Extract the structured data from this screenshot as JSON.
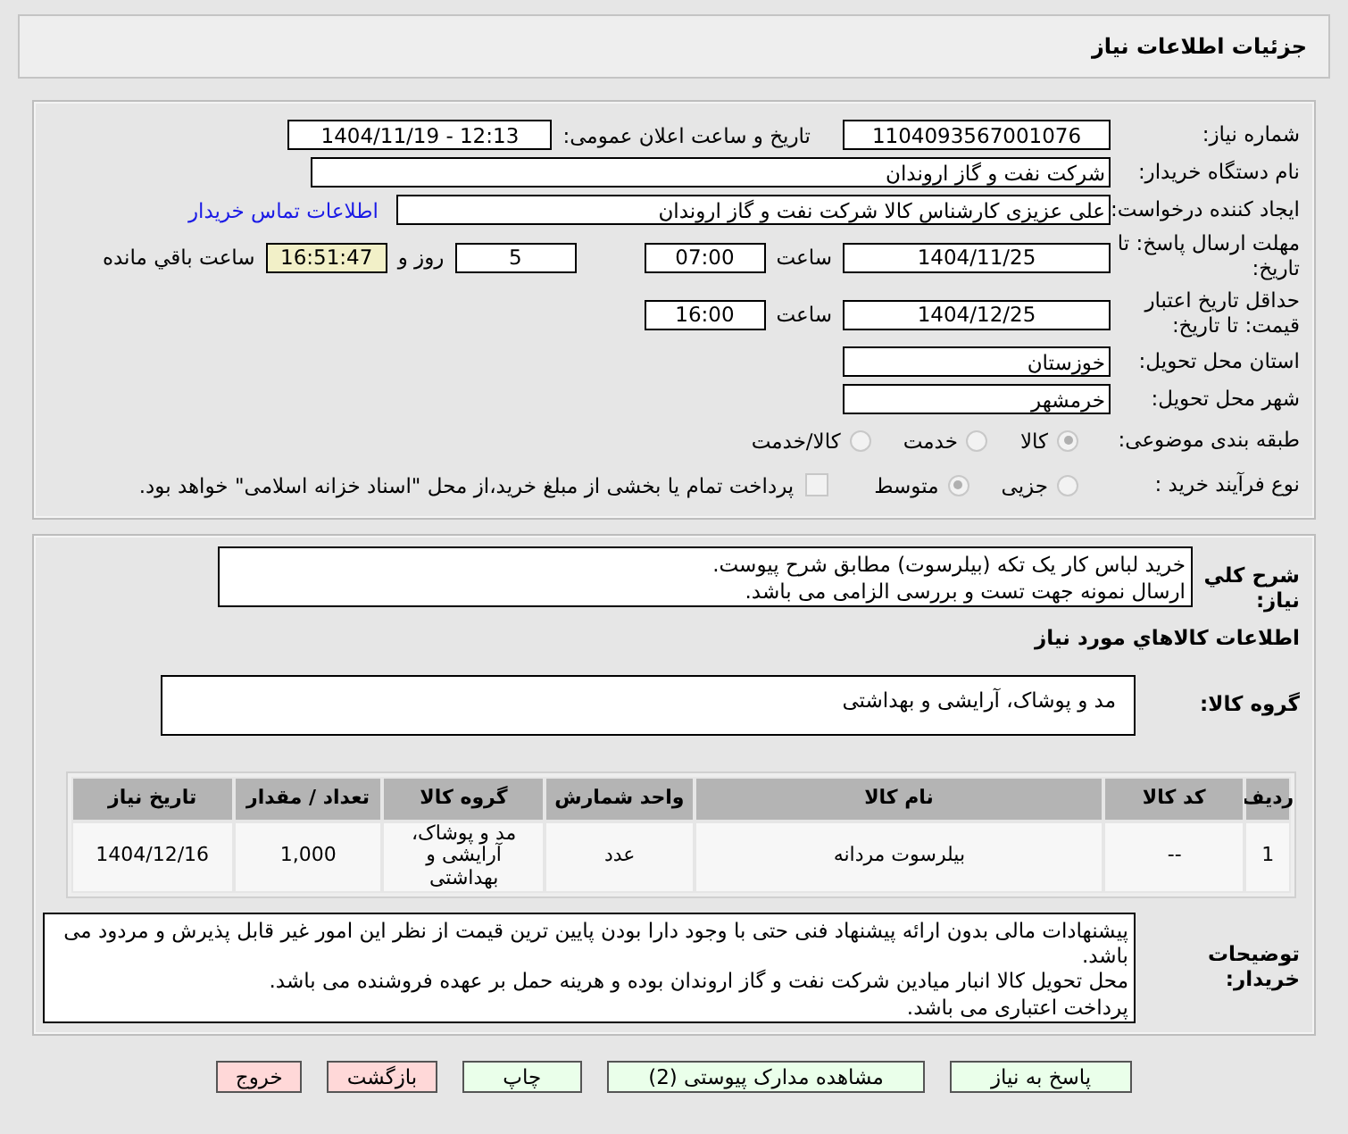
{
  "header": {
    "title": "جزئیات اطلاعات نیاز"
  },
  "need_number": {
    "label": "شماره نیاز:",
    "value": "1104093567001076"
  },
  "announce": {
    "label": "تاریخ و ساعت اعلان عمومی:",
    "value": "1404/11/19 - 12:13"
  },
  "buyer_org": {
    "label": "نام دستگاه خریدار:",
    "value": "شرکت نفت و گاز اروندان"
  },
  "requester": {
    "label": "ایجاد کننده درخواست:",
    "value": "علی عزیزی کارشناس کالا شرکت نفت و گاز اروندان",
    "link": "اطلاعات تماس خریدار"
  },
  "deadline": {
    "label": "مهلت ارسال پاسخ: تا تاریخ:",
    "date": "1404/11/25",
    "time_label": "ساعت",
    "time": "07:00",
    "days": "5",
    "days_label": "روز و",
    "remaining": "16:51:47",
    "remaining_label": "ساعت باقي مانده"
  },
  "validity": {
    "label": "حداقل تاریخ اعتبار قیمت: تا تاریخ:",
    "date": "1404/12/25",
    "time_label": "ساعت",
    "time": "16:00"
  },
  "province": {
    "label": "استان محل تحویل:",
    "value": "خوزستان"
  },
  "city": {
    "label": "شهر محل تحویل:",
    "value": "خرمشهر"
  },
  "category": {
    "label": "طبقه بندی موضوعی:",
    "options": [
      {
        "label": "کالا",
        "selected": true
      },
      {
        "label": "خدمت",
        "selected": false
      },
      {
        "label": "کالا/خدمت",
        "selected": false
      }
    ]
  },
  "process": {
    "label": "نوع فرآیند خرید :",
    "options": [
      {
        "label": "جزیی",
        "selected": false
      },
      {
        "label": "متوسط",
        "selected": true
      }
    ],
    "payment": {
      "label": "پرداخت تمام یا بخشی از مبلغ خرید،از محل \"اسناد خزانه اسلامی\" خواهد بود.",
      "checked": false
    }
  },
  "description": {
    "label": "شرح کلي نیاز:",
    "lines": [
      "خرید لباس کار یک تکه (بیلرسوت) مطابق شرح پیوست.",
      "ارسال نمونه جهت تست و بررسی الزامی می باشد."
    ]
  },
  "goods_title": "اطلاعات کالاهاي مورد نیاز",
  "goods_group": {
    "label": "گروه کالا:",
    "value": "مد و پوشاک، آرایشی و بهداشتی"
  },
  "table": {
    "columns": [
      "ردیف",
      "کد کالا",
      "نام کالا",
      "واحد شمارش",
      "گروه کالا",
      "تعداد / مقدار",
      "تاریخ نیاز"
    ],
    "rows": [
      [
        "1",
        "--",
        "بیلرسوت مردانه",
        "عدد",
        "مد و پوشاک، آرایشی و بهداشتی",
        "1,000",
        "1404/12/16"
      ]
    ]
  },
  "buyer_notes": {
    "label": "توضیحات خریدار:",
    "lines": [
      "پیشنهادات مالی بدون ارائه پیشنهاد فنی حتی با وجود دارا بودن پایین ترین قیمت از نظر این امور غیر قابل پذیرش و مردود می باشد.",
      "محل تحویل کالا انبار میادین شرکت نفت و گاز اروندان بوده و هرینه حمل بر عهده فروشنده می باشد.",
      "پرداخت اعتباری می باشد."
    ]
  },
  "buttons": [
    {
      "label": "پاسخ به نیاز",
      "kind": "normal"
    },
    {
      "label": "مشاهده مدارک پیوستی (2)",
      "kind": "normal"
    },
    {
      "label": "چاپ",
      "kind": "normal"
    },
    {
      "label": "بازگشت",
      "kind": "danger"
    },
    {
      "label": "خروج",
      "kind": "danger"
    }
  ]
}
